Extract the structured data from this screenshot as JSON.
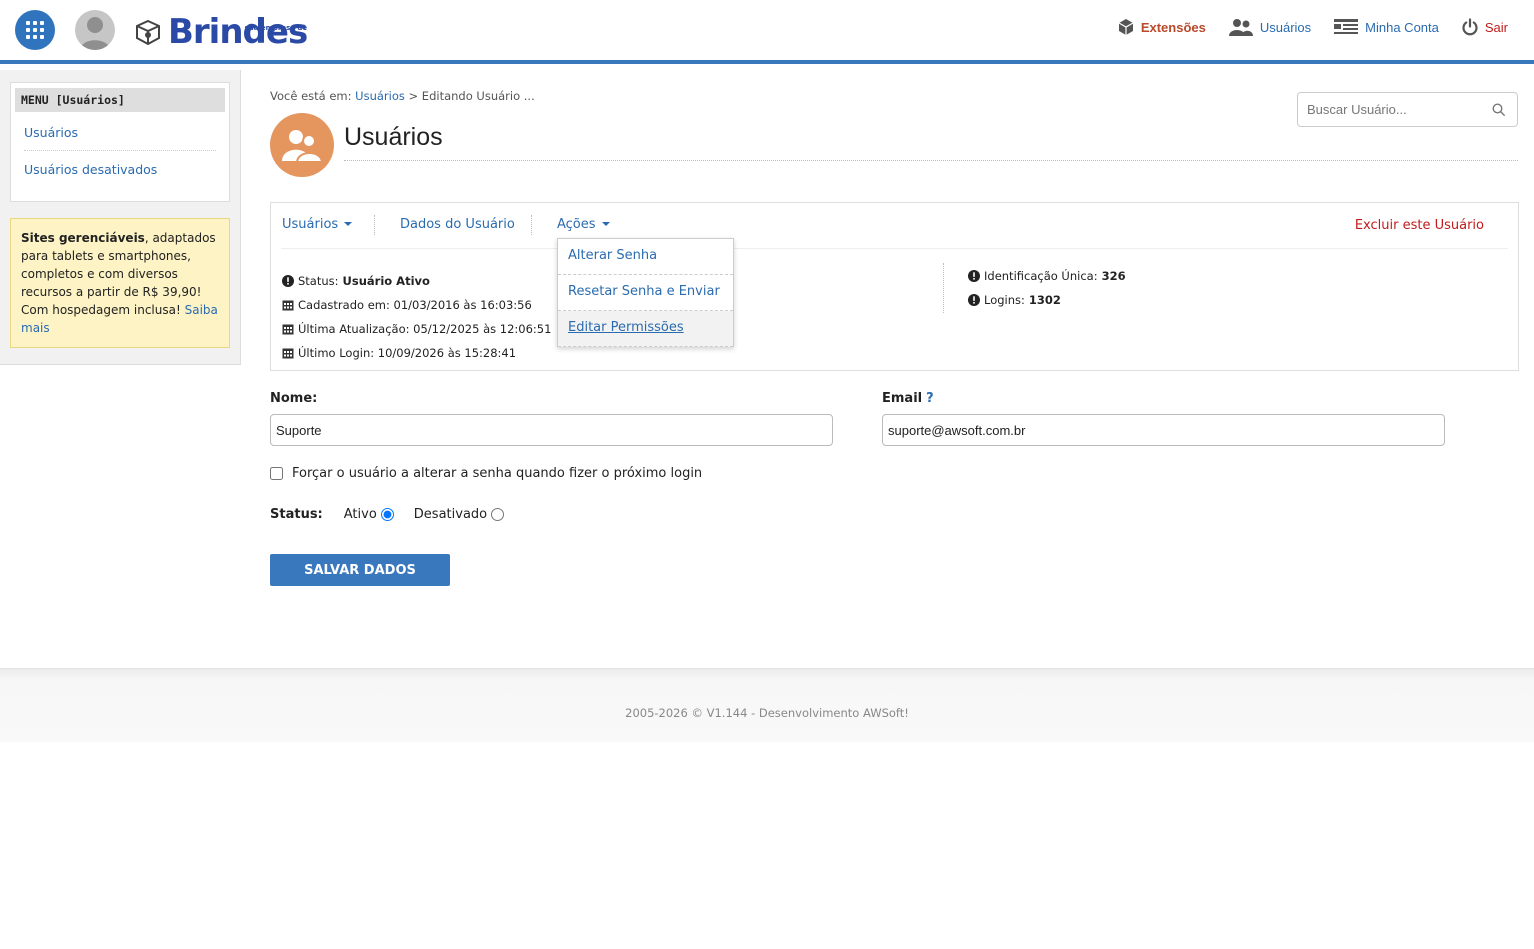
{
  "header": {
    "logo_text": "Brindes",
    "logo_tagline": "sua empresa de",
    "nav": [
      {
        "label": "Extensões",
        "icon": "cube-icon"
      },
      {
        "label": "Usuários",
        "icon": "users-icon"
      },
      {
        "label": "Minha Conta",
        "icon": "account-icon"
      },
      {
        "label": "Sair",
        "icon": "power-icon"
      }
    ]
  },
  "sidebar": {
    "menu_title": "MENU [Usuários]",
    "items": [
      {
        "label": "Usuários"
      },
      {
        "label": "Usuários desativados"
      }
    ],
    "promo": {
      "bold": "Sites gerenciáveis",
      "text": ", adaptados para tablets e smartphones, completos e com diversos recursos a partir de R$ 39,90! Com hospedagem inclusa!",
      "link": "Saiba mais"
    }
  },
  "breadcrumb": {
    "prefix": "Você está em:",
    "link": "Usuários",
    "current": "> Editando Usuário ..."
  },
  "search": {
    "placeholder": "Buscar Usuário..."
  },
  "page": {
    "title": "Usuários"
  },
  "tabs": {
    "users": "Usuários",
    "user_data": "Dados do Usuário",
    "actions": "Ações",
    "delete": "Excluir este Usuário"
  },
  "dropdown": {
    "items": [
      "Alterar Senha",
      "Resetar Senha e Enviar",
      "Editar Permissões"
    ]
  },
  "info": {
    "status_label": "Status:",
    "status_value": "Usuário Ativo",
    "registered": "Cadastrado em: 01/03/2016 às 16:03:56",
    "updated": "Última Atualização: 05/12/2025 às 12:06:51",
    "last_login": "Último Login: 10/09/2026 às 15:28:41",
    "unique_id_label": "Identificação Única:",
    "unique_id_value": "326",
    "logins_label": "Logins:",
    "logins_value": "1302"
  },
  "form": {
    "name_label": "Nome:",
    "name_value": "Suporte",
    "email_label": "Email",
    "email_help": "?",
    "email_value": "suporte@awsoft.com.br",
    "force_password_label": "Forçar o usuário a alterar a senha quando fizer o próximo login",
    "status_label": "Status:",
    "status_active": "Ativo",
    "status_disabled": "Desativado",
    "save_label": "SALVAR DADOS"
  },
  "footer": {
    "text": "2005-2026 © V1.144 - Desenvolvimento AWSoft!"
  },
  "colors": {
    "primary": "#3a78bd",
    "link": "#2a6bb0",
    "danger": "#c21b1b",
    "extensions": "#b94a2a",
    "page_icon": "#e5965f",
    "promo_bg": "#fdf3c4"
  }
}
